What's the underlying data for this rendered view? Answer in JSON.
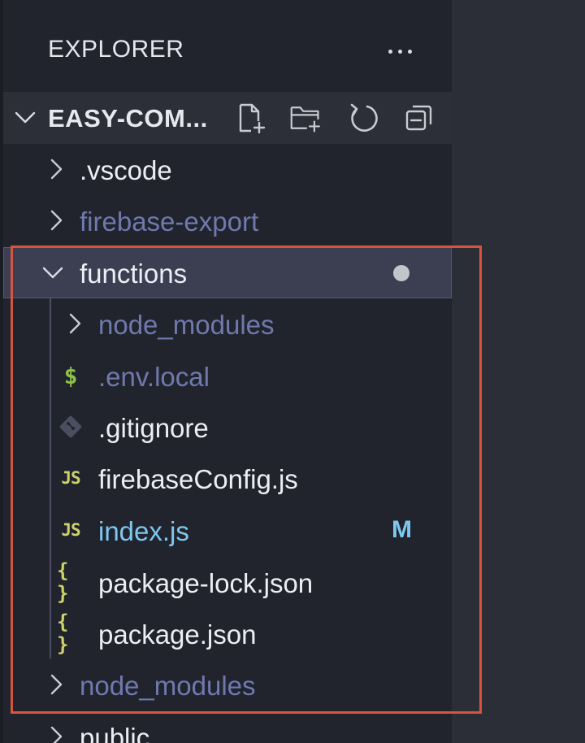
{
  "explorer": {
    "title": "EXPLORER",
    "more_actions_icon": "ellipsis-icon"
  },
  "workspace": {
    "name": "EASY-COM...",
    "expanded": true,
    "actions": [
      {
        "id": "new-file",
        "icon": "new-file-icon"
      },
      {
        "id": "new-folder",
        "icon": "new-folder-icon"
      },
      {
        "id": "refresh",
        "icon": "refresh-icon"
      },
      {
        "id": "collapse-all",
        "icon": "collapse-all-icon"
      }
    ]
  },
  "tree": {
    "items": [
      {
        "label": ".vscode",
        "type": "folder",
        "expanded": false,
        "depth": 0,
        "muted": false
      },
      {
        "label": "firebase-export",
        "type": "folder",
        "expanded": false,
        "depth": 0,
        "muted": true
      },
      {
        "label": "functions",
        "type": "folder",
        "expanded": true,
        "depth": 0,
        "selected": true,
        "badge": "dot"
      },
      {
        "label": "node_modules",
        "type": "folder",
        "expanded": false,
        "depth": 1,
        "muted": true
      },
      {
        "label": ".env.local",
        "type": "file",
        "icon": "dollar-icon",
        "icon_text": "$",
        "depth": 1,
        "muted": true
      },
      {
        "label": ".gitignore",
        "type": "file",
        "icon": "git-icon",
        "depth": 1
      },
      {
        "label": "firebaseConfig.js",
        "type": "file",
        "icon": "js-icon",
        "icon_text": "JS",
        "depth": 1
      },
      {
        "label": "index.js",
        "type": "file",
        "icon": "js-icon",
        "icon_text": "JS",
        "depth": 1,
        "modified": true,
        "badge": "M"
      },
      {
        "label": "package-lock.json",
        "type": "file",
        "icon": "json-icon",
        "icon_text": "{ }",
        "depth": 1
      },
      {
        "label": "package.json",
        "type": "file",
        "icon": "json-icon",
        "icon_text": "{ }",
        "depth": 1
      },
      {
        "label": "node_modules",
        "type": "folder",
        "expanded": false,
        "depth": 0,
        "muted": true
      },
      {
        "label": "public",
        "type": "folder",
        "expanded": false,
        "depth": 0
      }
    ]
  },
  "colors": {
    "sidebar_bg": "#22242d",
    "selected_bg": "#3c3f52",
    "highlight_border": "#d8543e",
    "muted_text": "#6f79ad",
    "modified_text": "#7cc8f0",
    "js_icon": "#cdd26a",
    "env_icon": "#8dc149"
  }
}
